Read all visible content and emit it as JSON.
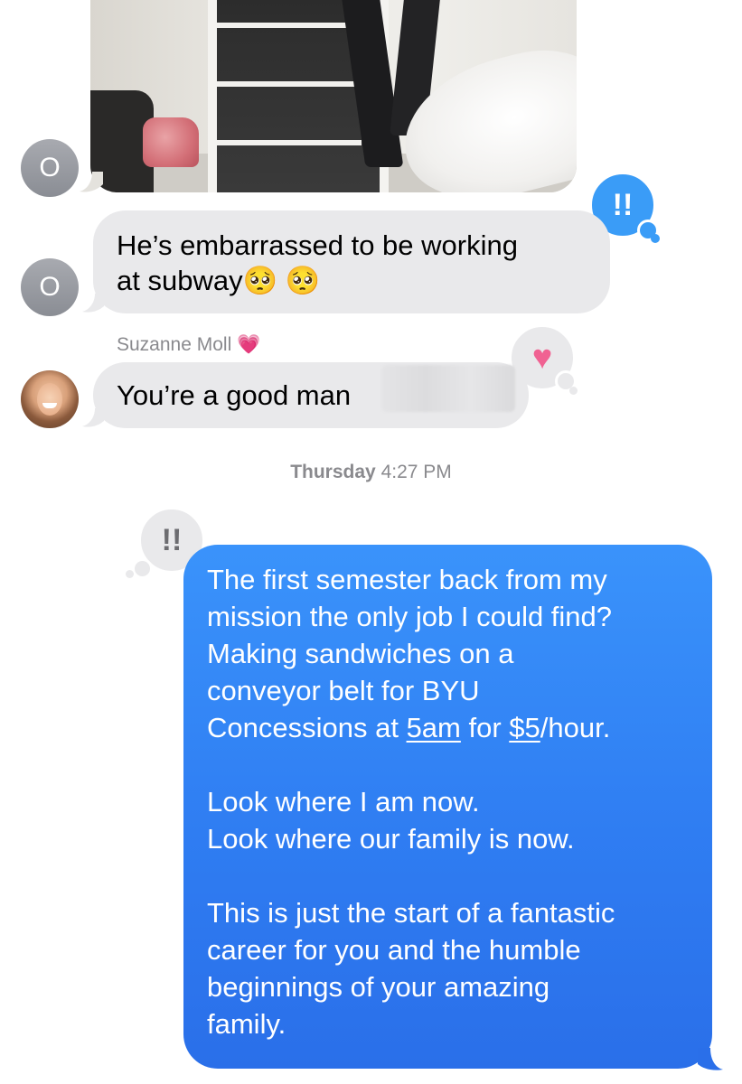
{
  "conversation": {
    "messages": [
      {
        "sender_initial": "O",
        "text_line1": "He’s embarrassed to be working",
        "text_line2": "at subway",
        "emoji": "🥺 🥺",
        "tapback": "!!"
      },
      {
        "sender_name": "Suzanne Moll",
        "sender_badge": "💗",
        "text": "You’re a good man",
        "tapback": "♥"
      }
    ],
    "first_avatar_initial": "O",
    "timestamp_day": "Thursday",
    "timestamp_time": "4:27 PM",
    "outgoing": {
      "tapback": "!!",
      "lines": [
        "The first semester back from my",
        "mission the only job I could find?",
        "Making sandwiches on a",
        "conveyor belt for BYU"
      ],
      "line5_prefix": "Concessions at ",
      "line5_link1": "5am",
      "line5_middle": " for ",
      "line5_link2": "$5",
      "line5_suffix": "/hour.",
      "para2_line1": "Look where I am now.",
      "para2_line2": "Look where our family is now.",
      "para3_lines": [
        "This is just the start of a fantastic",
        "career for you and the humble",
        "beginnings of your amazing",
        "family."
      ]
    }
  },
  "colors": {
    "incoming_bubble": "#e9e9eb",
    "outgoing_bubble": "#2f7df2",
    "tapback_blue": "#3a9cf7",
    "heart_pink": "#f06292",
    "meta_gray": "#8a8a8e"
  }
}
